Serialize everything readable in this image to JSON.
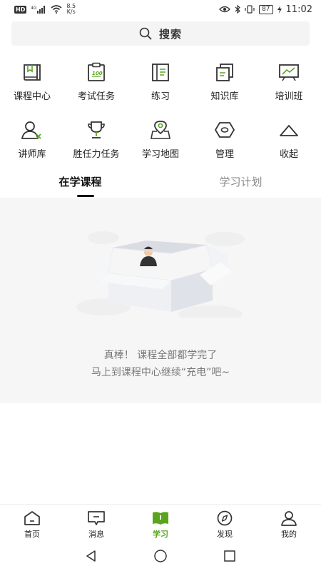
{
  "status_bar": {
    "hd_badge": "HD",
    "net_type": "4G",
    "net_speed_value": "8.5",
    "net_speed_unit": "K/s",
    "battery": "87",
    "time": "11:02"
  },
  "search": {
    "label": "搜索"
  },
  "features": [
    {
      "label": "课程中心",
      "icon": "book-icon"
    },
    {
      "label": "考试任务",
      "icon": "exam-icon"
    },
    {
      "label": "练习",
      "icon": "practice-icon"
    },
    {
      "label": "知识库",
      "icon": "knowledge-icon"
    },
    {
      "label": "培训班",
      "icon": "training-icon"
    },
    {
      "label": "讲师库",
      "icon": "lecturer-icon"
    },
    {
      "label": "胜任力任务",
      "icon": "trophy-icon"
    },
    {
      "label": "学习地图",
      "icon": "map-pin-icon"
    },
    {
      "label": "管理",
      "icon": "hexagon-nut-icon"
    },
    {
      "label": "收起",
      "icon": "collapse-icon"
    }
  ],
  "tabs": [
    {
      "label": "在学课程",
      "active": true
    },
    {
      "label": "学习计划",
      "active": false
    }
  ],
  "empty_state": {
    "line1": "真棒！ 课程全部都学完了",
    "line2": "马上到课程中心继续“充电”吧~"
  },
  "bottom_nav": [
    {
      "label": "首页",
      "icon": "home-icon",
      "active": false
    },
    {
      "label": "消息",
      "icon": "message-icon",
      "active": false
    },
    {
      "label": "学习",
      "icon": "study-icon",
      "active": true
    },
    {
      "label": "发现",
      "icon": "compass-icon",
      "active": false
    },
    {
      "label": "我的",
      "icon": "profile-icon",
      "active": false
    }
  ],
  "colors": {
    "accent": "#5aa51d",
    "text": "#222222",
    "muted": "#888888"
  }
}
